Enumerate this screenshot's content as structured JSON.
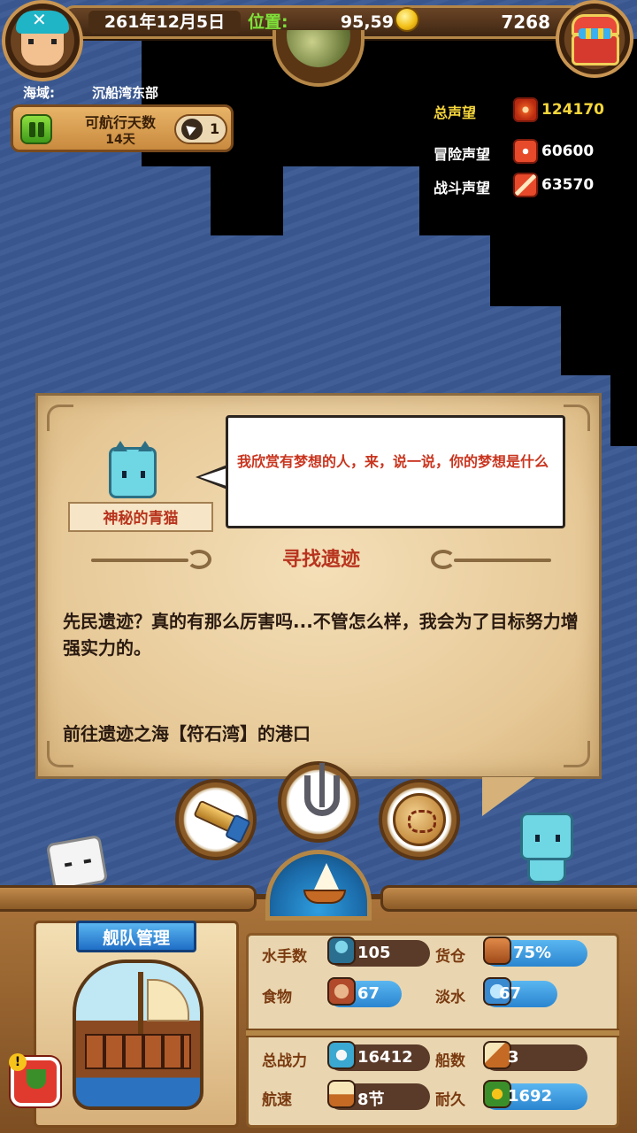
{
  "header": {
    "date": "261年12月5日",
    "position_label": "位置:",
    "position_value": "95,59",
    "gold": "7268",
    "icons": [
      "captain-avatar-icon",
      "coin-icon",
      "globe-icon",
      "treasure-chest-icon"
    ]
  },
  "region": {
    "label": "海域:",
    "name": "沉船湾东部"
  },
  "sailing": {
    "label": "可航行天数",
    "days": "14天",
    "auto_count": "1"
  },
  "reputation": {
    "total_label": "总声望",
    "total_value": "124170",
    "adventure_label": "冒险声望",
    "adventure_value": "60600",
    "battle_label": "战斗声望",
    "battle_value": "63570",
    "colors": {
      "total": "#f6d63b",
      "normal": "#ffffff"
    }
  },
  "quest": {
    "npc_name": "神秘的青猫",
    "speech": "我欣赏有梦想的人，来，说一说，你的梦想是什么",
    "title": "寻找遗迹",
    "body": "先民遗迹？真的有那么厉害吗...不管怎么样，我会为了目标努力增强实力的。",
    "goal": "前往遗迹之海【符石湾】的港口"
  },
  "actions": [
    "telescope-icon",
    "anchor-icon",
    "map-icon",
    "ship-icon"
  ],
  "fleet": {
    "title": "舰队管理",
    "stats": {
      "sailors_label": "水手数",
      "sailors_value": "105",
      "cargo_label": "货仓",
      "cargo_value": "75%",
      "food_label": "食物",
      "food_value": "67",
      "water_label": "淡水",
      "water_value": "67",
      "power_label": "总战力",
      "power_value": "16412",
      "ships_label": "船数",
      "ships_value": "3",
      "speed_label": "航速",
      "speed_value": "8节",
      "durability_label": "耐久",
      "durability_value": "1692"
    }
  }
}
